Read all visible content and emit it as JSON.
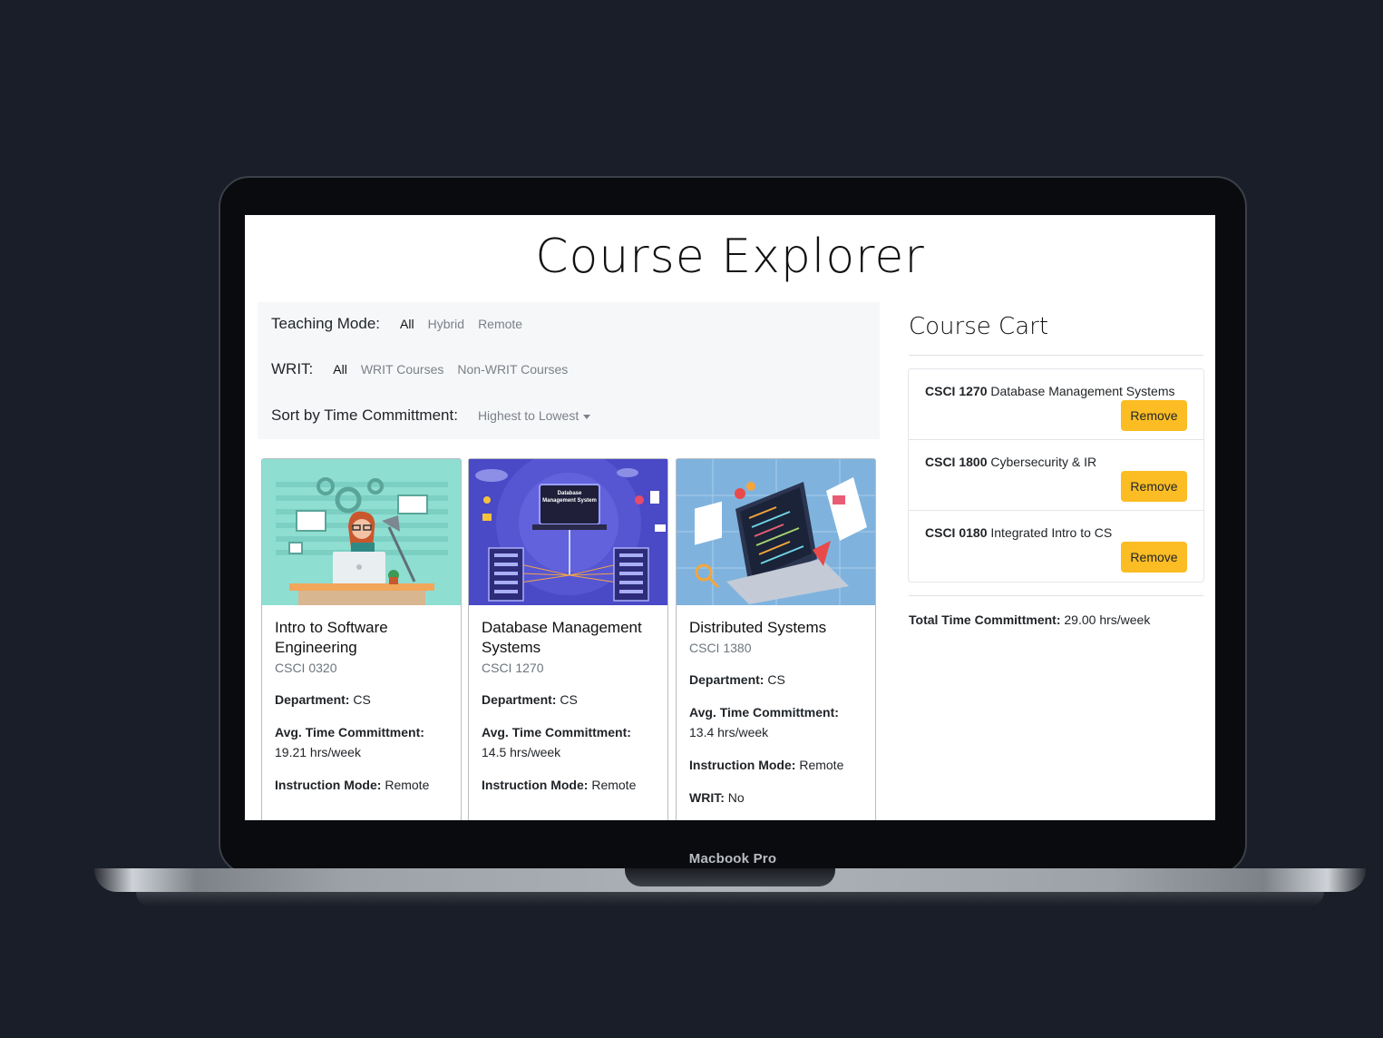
{
  "device_label": "Macbook Pro",
  "app_title": "Course Explorer",
  "filters": {
    "teaching_mode": {
      "label": "Teaching Mode:",
      "options": [
        "All",
        "Hybrid",
        "Remote"
      ],
      "selected": "All"
    },
    "writ": {
      "label": "WRIT:",
      "options": [
        "All",
        "WRIT Courses",
        "Non-WRIT Courses"
      ],
      "selected": "All"
    },
    "sort": {
      "label": "Sort by Time Committment:",
      "value": "Highest to Lowest"
    }
  },
  "cards": [
    {
      "title": "Intro to Software Engineering",
      "code": "CSCI 0320",
      "department_label": "Department:",
      "department": "CS",
      "time_label": "Avg. Time Committment:",
      "time": "19.21 hrs/week",
      "mode_label": "Instruction Mode:",
      "mode": "Remote",
      "image": "developer-at-desk-illustration"
    },
    {
      "title": "Database Management Systems",
      "code": "CSCI 1270",
      "department_label": "Department:",
      "department": "CS",
      "time_label": "Avg. Time Committment:",
      "time": "14.5 hrs/week",
      "mode_label": "Instruction Mode:",
      "mode": "Remote",
      "image_text": "Database Management System"
    },
    {
      "title": "Distributed Systems",
      "code": "CSCI 1380",
      "department_label": "Department:",
      "department": "CS",
      "time_label": "Avg. Time Committment:",
      "time": "13.4 hrs/week",
      "mode_label": "Instruction Mode:",
      "mode": "Remote",
      "writ_label": "WRIT:",
      "writ": "No",
      "image": "laptop-code-isometric-illustration"
    }
  ],
  "cart": {
    "title": "Course Cart",
    "items": [
      {
        "code": "CSCI 1270",
        "name": "Database Management Systems",
        "button": "Remove"
      },
      {
        "code": "CSCI 1800",
        "name": "Cybersecurity & IR",
        "button": "Remove"
      },
      {
        "code": "CSCI 0180",
        "name": "Integrated Intro to CS",
        "button": "Remove"
      }
    ],
    "total_label": "Total Time Committment:",
    "total_value": "29.00 hrs/week"
  },
  "colors": {
    "accent": "#fbbd23",
    "background": "#1a1e29",
    "filter_bg": "#f6f7f9"
  }
}
